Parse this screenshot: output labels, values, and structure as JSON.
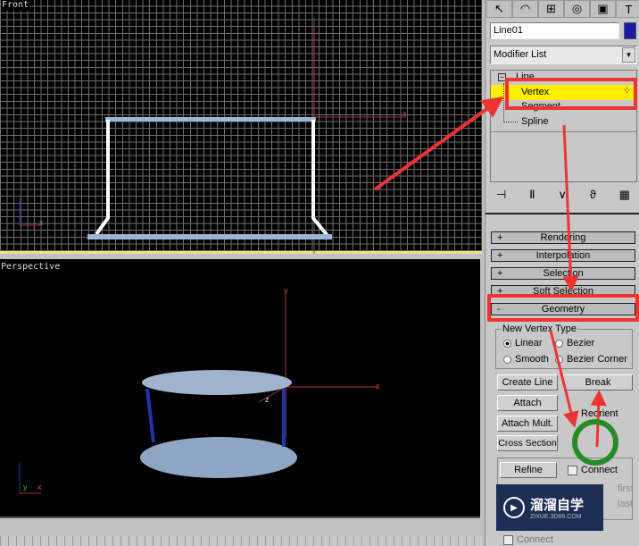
{
  "viewports": {
    "front": {
      "label": "Front",
      "axes": {
        "y": "y",
        "x": "x",
        "z": "z"
      }
    },
    "perspective": {
      "label": "Perspective",
      "axes": {
        "y": "y",
        "x": "x",
        "z": "z"
      }
    }
  },
  "panel": {
    "toolbar_icons": [
      "create-icon",
      "modify-icon",
      "hierarchy-icon",
      "motion-icon",
      "display-icon",
      "utilities-icon"
    ],
    "object_name": "Line01",
    "object_color": "#1a1aa8",
    "modifier_list": "Modifier List",
    "stack": {
      "root": "Line",
      "items": [
        "Vertex",
        "Segment",
        "Spline"
      ],
      "selected": "Vertex"
    },
    "stack_icons": [
      "pin-stack-icon",
      "show-end-result-icon",
      "make-unique-icon",
      "remove-modifier-icon",
      "configure-sets-icon"
    ],
    "rollouts": [
      {
        "sign": "+",
        "label": "Rendering"
      },
      {
        "sign": "+",
        "label": "Interpolation"
      },
      {
        "sign": "+",
        "label": "Selection"
      },
      {
        "sign": "+",
        "label": "Soft Selection"
      },
      {
        "sign": "-",
        "label": "Geometry"
      }
    ],
    "geometry": {
      "group_label": "New Vertex Type",
      "radios": [
        {
          "label": "Linear",
          "checked": true
        },
        {
          "label": "Bezier",
          "checked": false
        },
        {
          "label": "Smooth",
          "checked": false
        },
        {
          "label": "Bezier Corner",
          "checked": false
        }
      ],
      "buttons": {
        "create_line": "Create Line",
        "break": "Break",
        "attach": "Attach",
        "reorient": "Reorient",
        "attach_mult": "Attach Mult.",
        "cross_section": "Cross Section",
        "refine": "Refine"
      },
      "connect": "Connect",
      "first": "first",
      "last": "last",
      "connect2": "Connect"
    }
  },
  "watermark": {
    "title": "溜溜自学",
    "url": "ZIXUE.3D66.COM"
  },
  "annotation_colors": {
    "arrow": "#ee3333",
    "circle": "#2a8a2a",
    "highlight": "#ffee00"
  }
}
